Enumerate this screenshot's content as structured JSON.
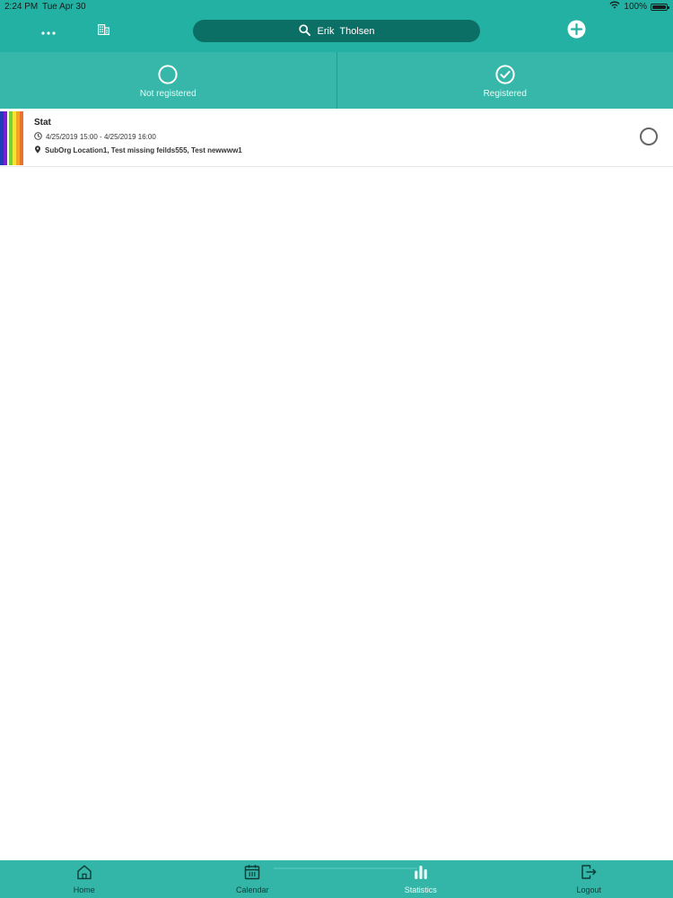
{
  "status_bar": {
    "time": "2:24 PM",
    "date": "Tue Apr 30",
    "battery": "100%",
    "battery_level": 1.0,
    "wifi_icon": "wifi-icon"
  },
  "header": {
    "search_text": "Erik  Tholsen",
    "icons": {
      "more": "more-icon",
      "organization": "building-icon",
      "search": "search-icon",
      "add": "plus-circle-icon"
    }
  },
  "filter_tabs": [
    {
      "label": "Not registered",
      "icon": "circle-icon"
    },
    {
      "label": "Registered",
      "icon": "check-circle-icon"
    }
  ],
  "events": [
    {
      "title": "Stat",
      "time": "4/25/2019 15:00 - 4/25/2019 16:00",
      "location": "SubOrg Location1, Test missing feilds555, Test newwww1",
      "registered": false,
      "category_colors": [
        "#1f3fb8",
        "#7b1fd4",
        "#78d13a",
        "#f2e533",
        "#f3a51b",
        "#e8732a"
      ]
    }
  ],
  "tab_bar": {
    "items": [
      {
        "label": "Home",
        "icon": "home-icon",
        "active": false
      },
      {
        "label": "Calendar",
        "icon": "calendar-icon",
        "active": false
      },
      {
        "label": "Statistics",
        "icon": "bar-chart-icon",
        "active": true
      },
      {
        "label": "Logout",
        "icon": "logout-icon",
        "active": false
      }
    ]
  },
  "colors": {
    "header": "#23b1a3",
    "filter_bar": "#36b7a9",
    "search_pill": "#0c6f65",
    "tab_bar": "#33b5a8"
  }
}
